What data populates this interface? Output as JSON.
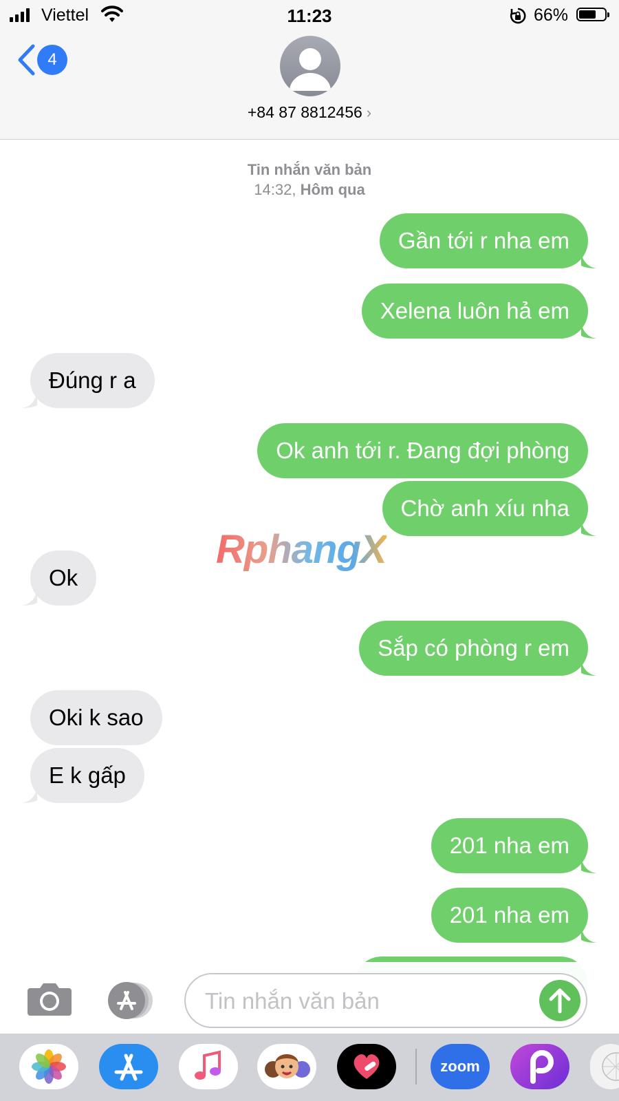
{
  "status_bar": {
    "carrier": "Viettel",
    "time": "11:23",
    "battery_percent": "66%",
    "battery_level": 0.66
  },
  "header": {
    "back_badge": "4",
    "contact": "+84 87 8812456",
    "contact_chevron": "›"
  },
  "conversation": {
    "service_label": "Tin nhắn văn bản",
    "time": "14:32,",
    "day": "Hôm qua",
    "messages": [
      {
        "dir": "out",
        "text": "Gần tới r nha em"
      },
      {
        "dir": "out",
        "text": "Xelena luôn hả em"
      },
      {
        "dir": "in",
        "text": "Đúng r a"
      },
      {
        "dir": "out",
        "text": "Ok anh tới r. Đang đợi phòng"
      },
      {
        "dir": "out",
        "text": "Chờ anh xíu nha"
      },
      {
        "dir": "in",
        "text": "Ok"
      },
      {
        "dir": "out",
        "text": "Sắp có phòng r em"
      },
      {
        "dir": "in",
        "text": "Oki k sao"
      },
      {
        "dir": "in",
        "text": "E k gấp"
      },
      {
        "dir": "out",
        "text": "201 nha em"
      },
      {
        "dir": "out",
        "text": "201 nha em"
      }
    ]
  },
  "watermark": "RphangX",
  "input": {
    "placeholder": "Tin nhắn văn bản",
    "value": ""
  },
  "app_drawer": {
    "apps": [
      "photos-icon",
      "app-store-icon",
      "music-icon",
      "memoji-icon",
      "heart-app-icon",
      "zoom-icon",
      "picsart-icon",
      "grid-app-icon"
    ],
    "zoom_label": "zoom"
  },
  "colors": {
    "sms_bubble": "#6fcf6a",
    "received_bubble": "#e9e9eb",
    "ios_blue": "#2f7cf6"
  }
}
